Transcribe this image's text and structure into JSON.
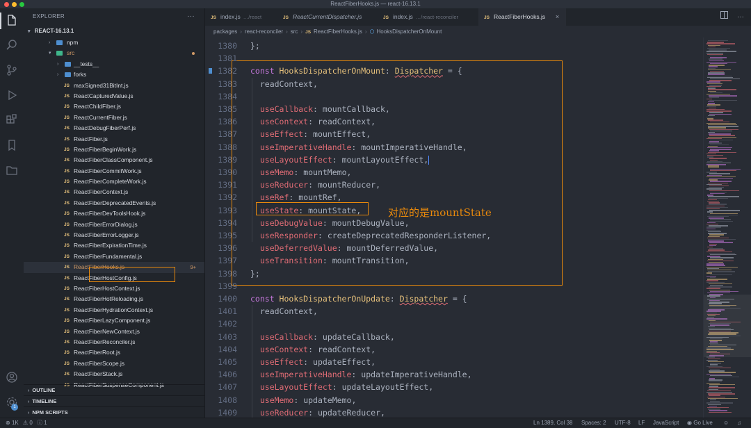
{
  "window": {
    "title": "ReactFiberHooks.js — react-16.13.1"
  },
  "explorer": {
    "header": "EXPLORER",
    "more": "···",
    "root": "REACT-16.13.1",
    "folders": [
      {
        "label": "npm",
        "open": false
      },
      {
        "label": "src",
        "open": true
      },
      {
        "label": "__tests__",
        "open": false
      },
      {
        "label": "forks",
        "open": false
      }
    ],
    "files": [
      "maxSigned31BitInt.js",
      "ReactCapturedValue.js",
      "ReactChildFiber.js",
      "ReactCurrentFiber.js",
      "ReactDebugFiberPerf.js",
      "ReactFiber.js",
      "ReactFiberBeginWork.js",
      "ReactFiberClassComponent.js",
      "ReactFiberCommitWork.js",
      "ReactFiberCompleteWork.js",
      "ReactFiberContext.js",
      "ReactFiberDeprecatedEvents.js",
      "ReactFiberDevToolsHook.js",
      "ReactFiberErrorDialog.js",
      "ReactFiberErrorLogger.js",
      "ReactFiberExpirationTime.js",
      "ReactFiberFundamental.js",
      "ReactFiberHooks.js",
      "ReactFiberHostConfig.js",
      "ReactFiberHostContext.js",
      "ReactFiberHotReloading.js",
      "ReactFiberHydrationContext.js",
      "ReactFiberLazyComponent.js",
      "ReactFiberNewContext.js",
      "ReactFiberReconciler.js",
      "ReactFiberRoot.js",
      "ReactFiberScope.js",
      "ReactFiberStack.js",
      "ReactFiberSuspenseComponent.js"
    ],
    "js_tag": "JS",
    "selected_badge": "9+",
    "sections": [
      "OUTLINE",
      "TIMELINE",
      "NPM SCRIPTS"
    ]
  },
  "tabs": [
    {
      "label": "index.js",
      "desc": "…/react",
      "active": false
    },
    {
      "label": "ReactCurrentDispatcher.js",
      "desc": "",
      "active": false
    },
    {
      "label": "index.js",
      "desc": "…/react-reconciler",
      "active": false
    },
    {
      "label": "ReactFiberHooks.js",
      "desc": "",
      "active": true
    }
  ],
  "breadcrumb": [
    "packages",
    "react-reconciler",
    "src",
    "ReactFiberHooks.js",
    "HooksDispatcherOnMount"
  ],
  "editor": {
    "lines": [
      {
        "n": "1380",
        "t": "};"
      },
      {
        "n": "1381",
        "t": ""
      },
      {
        "n": "1382",
        "t": "const HooksDispatcherOnMount: Dispatcher = {"
      },
      {
        "n": "1383",
        "t": "  readContext,"
      },
      {
        "n": "1384",
        "t": ""
      },
      {
        "n": "1385",
        "t": "  useCallback: mountCallback,"
      },
      {
        "n": "1386",
        "t": "  useContext: readContext,"
      },
      {
        "n": "1387",
        "t": "  useEffect: mountEffect,"
      },
      {
        "n": "1388",
        "t": "  useImperativeHandle: mountImperativeHandle,"
      },
      {
        "n": "1389",
        "t": "  useLayoutEffect: mountLayoutEffect,"
      },
      {
        "n": "1390",
        "t": "  useMemo: mountMemo,"
      },
      {
        "n": "1391",
        "t": "  useReducer: mountReducer,"
      },
      {
        "n": "1392",
        "t": "  useRef: mountRef,"
      },
      {
        "n": "1393",
        "t": "  useState: mountState,"
      },
      {
        "n": "1394",
        "t": "  useDebugValue: mountDebugValue,"
      },
      {
        "n": "1395",
        "t": "  useResponder: createDeprecatedResponderListener,"
      },
      {
        "n": "1396",
        "t": "  useDeferredValue: mountDeferredValue,"
      },
      {
        "n": "1397",
        "t": "  useTransition: mountTransition,"
      },
      {
        "n": "1398",
        "t": "};"
      },
      {
        "n": "1399",
        "t": ""
      },
      {
        "n": "1400",
        "t": "const HooksDispatcherOnUpdate: Dispatcher = {"
      },
      {
        "n": "1401",
        "t": "  readContext,"
      },
      {
        "n": "1402",
        "t": ""
      },
      {
        "n": "1403",
        "t": "  useCallback: updateCallback,"
      },
      {
        "n": "1404",
        "t": "  useContext: readContext,"
      },
      {
        "n": "1405",
        "t": "  useEffect: updateEffect,"
      },
      {
        "n": "1406",
        "t": "  useImperativeHandle: updateImperativeHandle,"
      },
      {
        "n": "1407",
        "t": "  useLayoutEffect: updateLayoutEffect,"
      },
      {
        "n": "1408",
        "t": "  useMemo: updateMemo,"
      },
      {
        "n": "1409",
        "t": "  useReducer: updateReducer,"
      }
    ],
    "annotation": "对应的是mountState"
  },
  "status": {
    "problems": "1K",
    "warnings": "0",
    "info": "1",
    "cursor": "Ln 1389, Col 38",
    "spaces": "Spaces: 2",
    "encoding": "UTF-8",
    "eol": "LF",
    "language": "JavaScript",
    "golive": "Go Live"
  },
  "colors": {
    "accent_orange": "#e8890c",
    "keyword": "#c678dd",
    "identifier": "#e5c07b",
    "property": "#e06c75"
  },
  "icons": {
    "activity": [
      "files-icon",
      "search-icon",
      "source-control-icon",
      "run-debug-icon",
      "extensions-icon",
      "bookmark-icon",
      "folder-icon",
      "account-icon",
      "settings-gear-icon"
    ]
  }
}
